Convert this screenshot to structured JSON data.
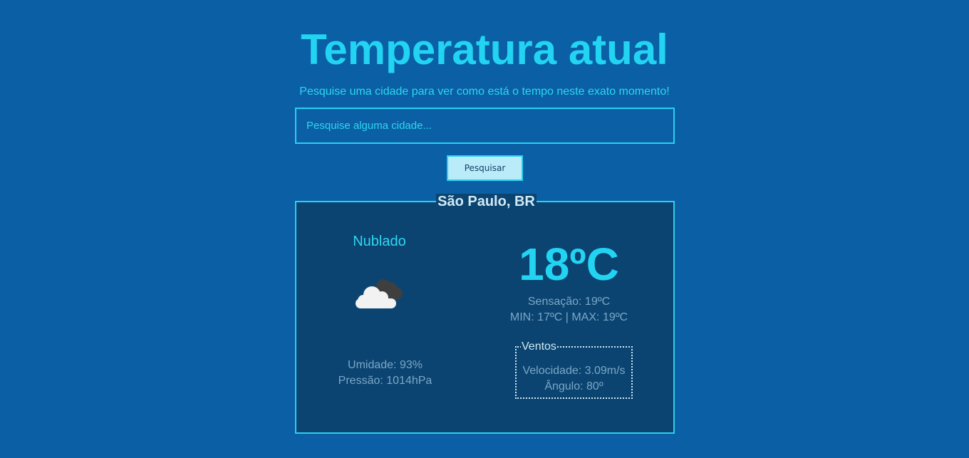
{
  "header": {
    "title": "Temperatura atual",
    "subtitle": "Pesquise uma cidade para ver como está o tempo neste exato momento!"
  },
  "search": {
    "placeholder": "Pesquise alguma cidade...",
    "value": "",
    "button_label": "Pesquisar"
  },
  "weather": {
    "city": "São Paulo, BR",
    "condition": "Nublado",
    "icon": "cloudy-icon",
    "humidity": "Umidade: 93%",
    "pressure": "Pressão: 1014hPa",
    "temperature": "18ºC",
    "feels_like": "Sensação: 19ºC",
    "min_max": "MIN: 17ºC | MAX: 19ºC",
    "winds": {
      "legend": "Ventos",
      "speed": "Velocidade: 3.09m/s",
      "angle": "Ângulo: 80º"
    }
  },
  "colors": {
    "background": "#0a5fa5",
    "accent": "#22d3f2",
    "card_background": "#0b4471",
    "muted_text": "#7ba8c7"
  }
}
